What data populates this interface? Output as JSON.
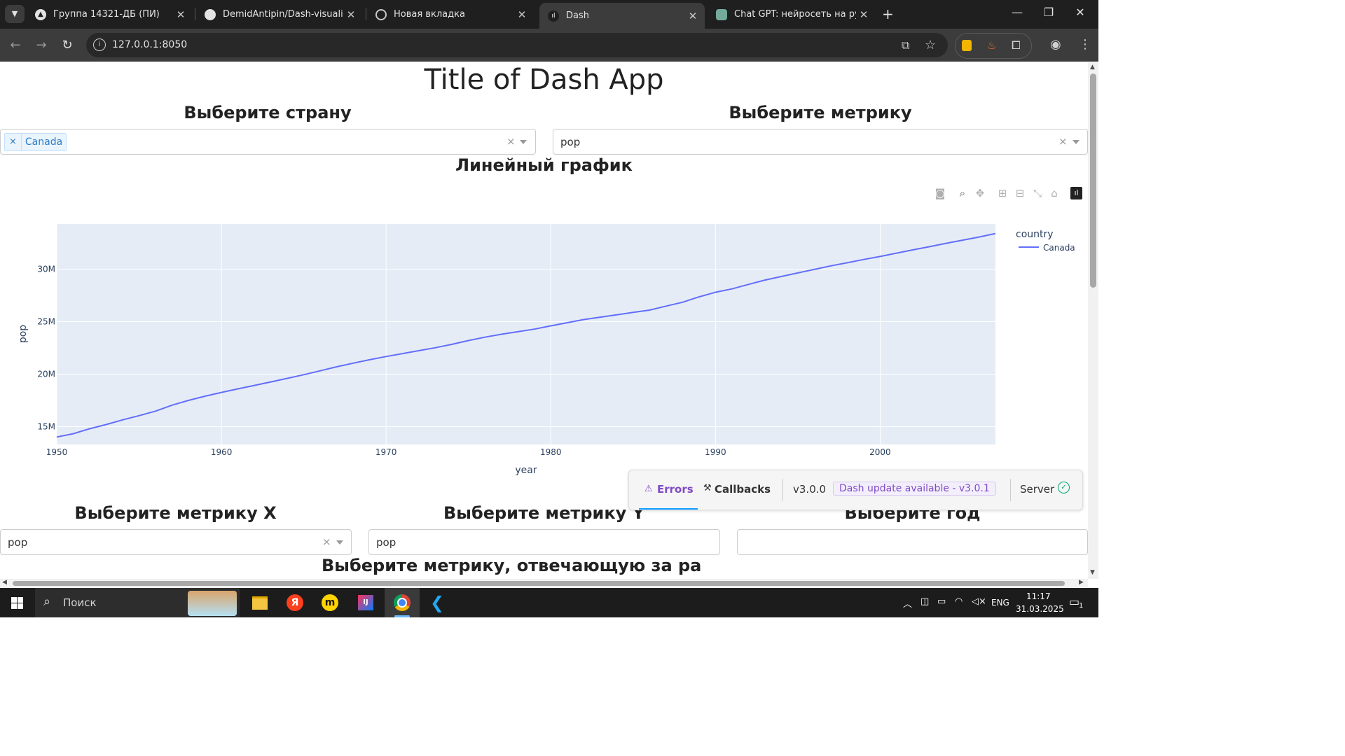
{
  "browser": {
    "tabs": [
      {
        "title": "Группа 14321-ДБ (ПИ)",
        "active": false
      },
      {
        "title": "DemidAntipin/Dash-visualisatio",
        "active": false
      },
      {
        "title": "Новая вкладка",
        "active": false
      },
      {
        "title": "Dash",
        "active": true
      },
      {
        "title": "Chat GPT: нейросеть на русско",
        "active": false
      }
    ],
    "url": "127.0.0.1:8050"
  },
  "app": {
    "title": "Title of Dash App",
    "country_label": "Выберите страну",
    "metric_label": "Выберите метрику",
    "country_selected": "Canada",
    "metric_value": "pop",
    "chart_heading": "Линейный график",
    "metric_x_label": "Выберите метрику X",
    "metric_y_label": "Выберите метрику Y",
    "year_label": "Выберите год",
    "metric_x_value": "pop",
    "metric_y_value": "pop",
    "size_label": "Выберите метрику, отвечающую за ра"
  },
  "chart_data": {
    "type": "line",
    "xlabel": "year",
    "ylabel": "pop",
    "legend_title": "country",
    "legend_position": "top-right",
    "xlim": [
      1950,
      2007
    ],
    "ylim": [
      13300000,
      34300000
    ],
    "x_ticks": [
      1950,
      1960,
      1970,
      1980,
      1990,
      2000
    ],
    "x_tick_labels": [
      "1950",
      "1960",
      "1970",
      "1980",
      "1990",
      "2000"
    ],
    "y_ticks": [
      15000000,
      20000000,
      25000000,
      30000000
    ],
    "y_tick_labels": [
      "15M",
      "20M",
      "25M",
      "30M"
    ],
    "series": [
      {
        "name": "Canada",
        "color": "#636efa",
        "x": [
          1950,
          1951,
          1952,
          1953,
          1954,
          1955,
          1956,
          1957,
          1958,
          1959,
          1960,
          1961,
          1962,
          1963,
          1964,
          1965,
          1966,
          1967,
          1968,
          1969,
          1970,
          1971,
          1972,
          1973,
          1974,
          1975,
          1976,
          1977,
          1978,
          1979,
          1980,
          1981,
          1982,
          1983,
          1984,
          1985,
          1986,
          1987,
          1988,
          1989,
          1990,
          1991,
          1992,
          1993,
          1994,
          1995,
          1996,
          1997,
          1998,
          1999,
          2000,
          2001,
          2002,
          2003,
          2004,
          2005,
          2006,
          2007
        ],
        "y": [
          14011422,
          14330000,
          14800000,
          15200000,
          15650000,
          16050000,
          16480000,
          17050000,
          17500000,
          17900000,
          18260000,
          18600000,
          18930000,
          19260000,
          19600000,
          19950000,
          20320000,
          20700000,
          21050000,
          21370000,
          21680000,
          21960000,
          22240000,
          22520000,
          22840000,
          23200000,
          23520000,
          23800000,
          24040000,
          24290000,
          24600000,
          24900000,
          25200000,
          25430000,
          25650000,
          25880000,
          26100000,
          26480000,
          26850000,
          27360000,
          27800000,
          28120000,
          28550000,
          28960000,
          29300000,
          29640000,
          29970000,
          30310000,
          30610000,
          30920000,
          31210000,
          31530000,
          31840000,
          32140000,
          32460000,
          32760000,
          33060000,
          33390000
        ]
      }
    ]
  },
  "devtools": {
    "errors_label": "Errors",
    "callbacks_label": "Callbacks",
    "version": "v3.0.0",
    "update": "Dash update available - v3.0.1",
    "server_label": "Server"
  },
  "taskbar": {
    "search_label": "Поиск",
    "lang": "ENG",
    "time": "11:17",
    "date": "31.03.2025",
    "notifications": "1"
  }
}
